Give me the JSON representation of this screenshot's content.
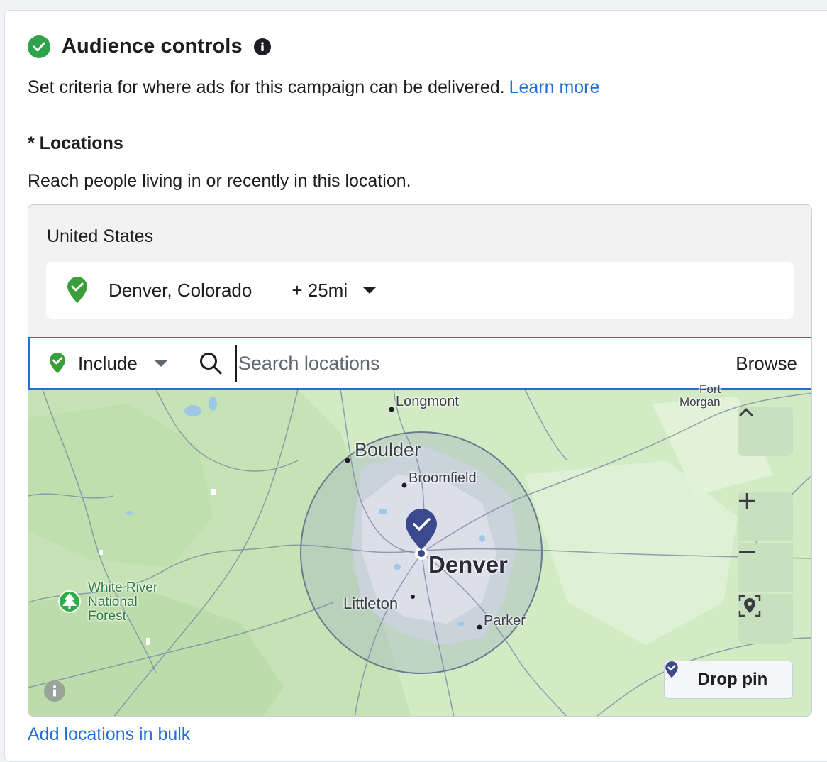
{
  "header": {
    "title": "Audience controls",
    "status_icon": "green-check-circle-icon",
    "info_icon": "info-icon"
  },
  "description": {
    "text": "Set criteria for where ads for this campaign can be delivered.",
    "link": "Learn more"
  },
  "locations": {
    "label": "* Locations",
    "help": "Reach people living in or recently in this location.",
    "country": "United States",
    "selected": {
      "name": "Denver, Colorado",
      "radius": "+ 25mi"
    },
    "search": {
      "include_label": "Include",
      "placeholder": "Search locations",
      "browse_label": "Browse"
    },
    "map": {
      "labels": {
        "longmont": "Longmont",
        "fort": "Fort",
        "morgan": "Morgan",
        "boulder": "Boulder",
        "broomfield": "Broomfield",
        "denver": "Denver",
        "littleton": "Littleton",
        "parker": "Parker",
        "white_river_1": "White River",
        "white_river_2": "National",
        "white_river_3": "Forest"
      },
      "drop_pin_label": "Drop pin"
    },
    "bulk_link": "Add locations in bulk"
  },
  "colors": {
    "accent_blue": "#216fdb",
    "success_green": "#31a24c",
    "pin_navy": "#3b4a8c"
  }
}
